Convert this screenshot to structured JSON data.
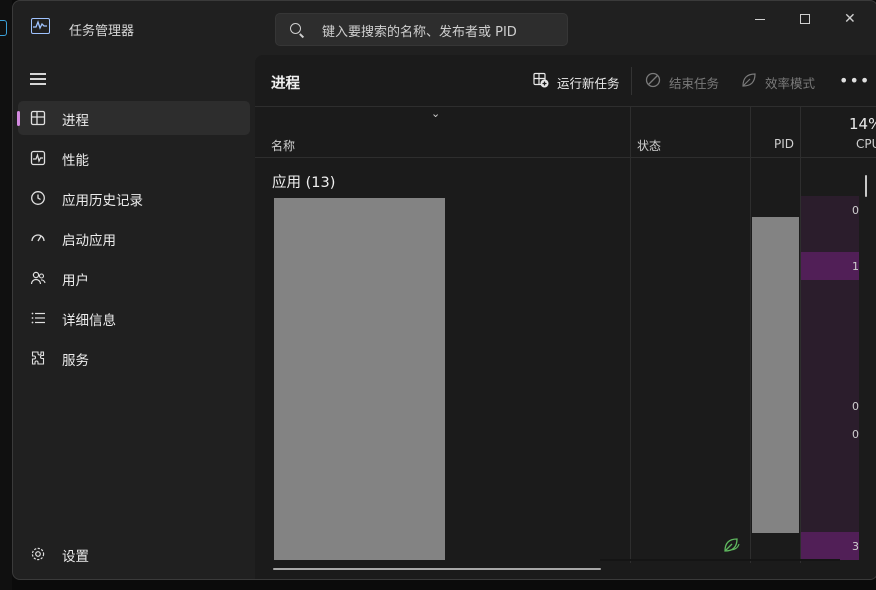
{
  "window": {
    "title": "任务管理器"
  },
  "search": {
    "placeholder": "键入要搜索的名称、发布者或 PID"
  },
  "sidebar": {
    "items": [
      {
        "label": "进程",
        "icon": "processes-icon",
        "active": true
      },
      {
        "label": "性能",
        "icon": "performance-icon"
      },
      {
        "label": "应用历史记录",
        "icon": "history-icon"
      },
      {
        "label": "启动应用",
        "icon": "startup-icon"
      },
      {
        "label": "用户",
        "icon": "users-icon"
      },
      {
        "label": "详细信息",
        "icon": "details-icon"
      },
      {
        "label": "服务",
        "icon": "services-icon"
      }
    ],
    "settings_label": "设置"
  },
  "toolbar": {
    "page_title": "进程",
    "run_new_task": "运行新任务",
    "end_task": "结束任务",
    "efficiency_mode": "效率模式",
    "more": "•••"
  },
  "table": {
    "columns": {
      "name": "名称",
      "status": "状态",
      "pid": "PID",
      "cpu": "CPU"
    },
    "cpu_total": "14%",
    "group_title": "应用 (13)",
    "cpu_values": [
      "0",
      "1",
      "0",
      "0",
      "3"
    ]
  },
  "colors": {
    "accent": "#d38ae0",
    "cpu_low": "#2b1d2c",
    "cpu_high": "#511f57",
    "efficiency_leaf": "#5fb85f"
  }
}
